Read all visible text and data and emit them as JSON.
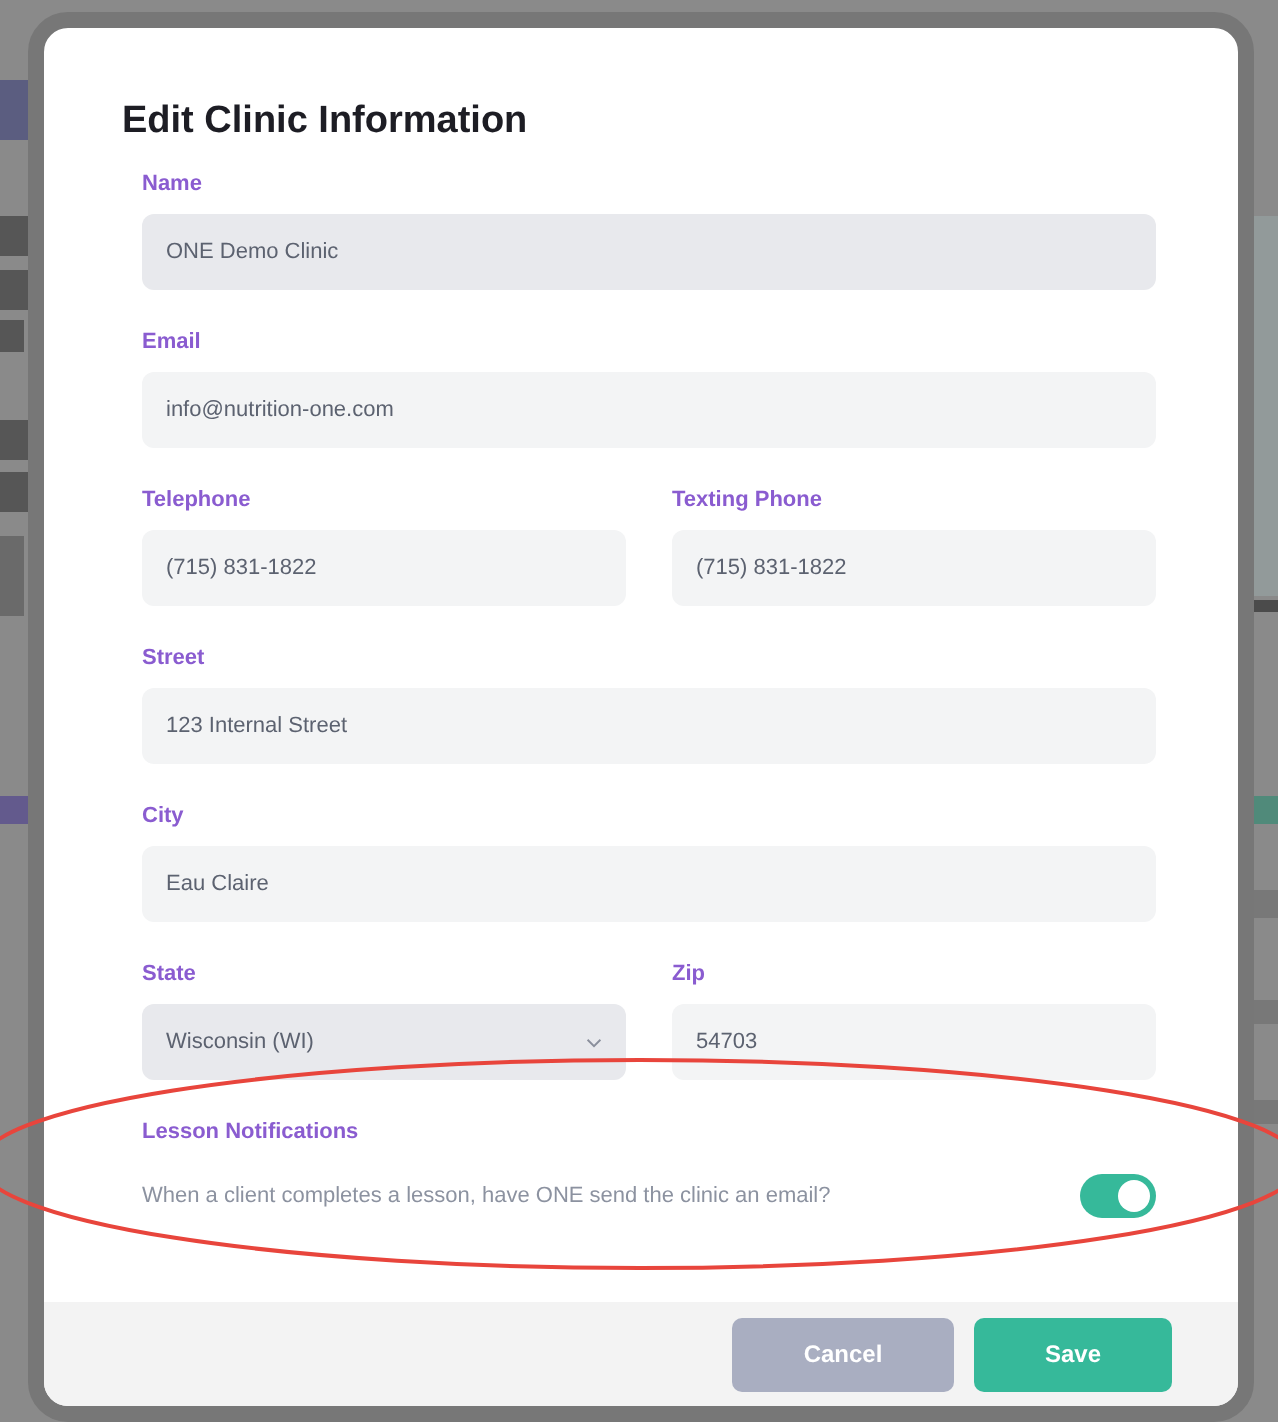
{
  "dialog": {
    "title": "Edit Clinic Information",
    "rows": [
      [
        {
          "label": "Name",
          "kind": "locked",
          "value": "ONE Demo Clinic"
        }
      ],
      [
        {
          "label": "Email",
          "kind": "text",
          "value": "info@nutrition-one.com"
        }
      ],
      [
        {
          "label": "Telephone",
          "kind": "text",
          "value": "(715) 831-1822"
        },
        {
          "label": "Texting Phone",
          "kind": "text",
          "value": "(715) 831-1822"
        }
      ],
      [
        {
          "label": "Street",
          "kind": "text",
          "value": "123  Internal Street"
        }
      ],
      [
        {
          "label": "City",
          "kind": "text",
          "value": "Eau Claire"
        }
      ],
      [
        {
          "label": "State",
          "kind": "select",
          "value": "Wisconsin (WI)"
        },
        {
          "label": "Zip",
          "kind": "text",
          "value": "54703"
        }
      ]
    ],
    "notifications": {
      "heading": "Lesson Notifications",
      "text": "When a client completes a lesson, have ONE send the clinic an email?",
      "on": true
    },
    "buttons": [
      {
        "label": "Cancel",
        "kind": "secondary"
      },
      {
        "label": "Save",
        "kind": "primary"
      }
    ]
  },
  "annotation": {
    "kind": "ellipse"
  }
}
